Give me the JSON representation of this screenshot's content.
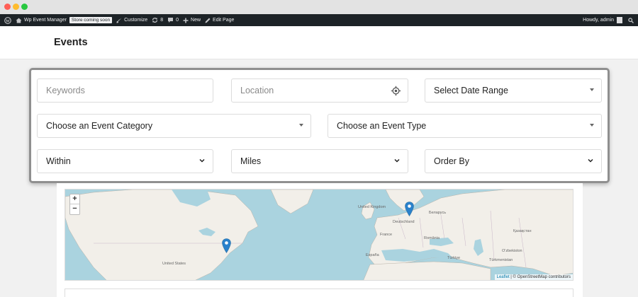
{
  "adminbar": {
    "site_name": "Wp Event Manager",
    "store_badge": "Store coming soon",
    "customize": "Customize",
    "updates_count": "8",
    "comments_count": "0",
    "new_label": "New",
    "edit_page": "Edit Page",
    "howdy": "Howdy, admin"
  },
  "header": {
    "title": "Events"
  },
  "search": {
    "keywords_placeholder": "Keywords",
    "location_placeholder": "Location",
    "date_range": "Select Date Range",
    "event_category": "Choose an Event Category",
    "event_type": "Choose an Event Type",
    "within": "Within",
    "distance_unit": "Miles",
    "order_by": "Order By"
  },
  "map": {
    "zoom_in": "+",
    "zoom_out": "−",
    "attribution_leaflet": "Leaflet",
    "attribution_rest": " | © OpenStreetMap contributors",
    "labels": {
      "united_states": "United States",
      "united_kingdom": "United Kingdom",
      "deutschland": "Deutschland",
      "belarus": "Беларусь",
      "france": "France",
      "espana": "España",
      "romania": "România",
      "turkiye": "Türkiye",
      "kazakhstan": "Қазақстан",
      "uzbekistan": "O'zbekiston",
      "turkmenistan": "Türkmenistan"
    },
    "marker_color": "#2a81cb"
  },
  "colors": {
    "adminbar_bg": "#1d2327",
    "water": "#aad3df",
    "land": "#f2efe9"
  }
}
